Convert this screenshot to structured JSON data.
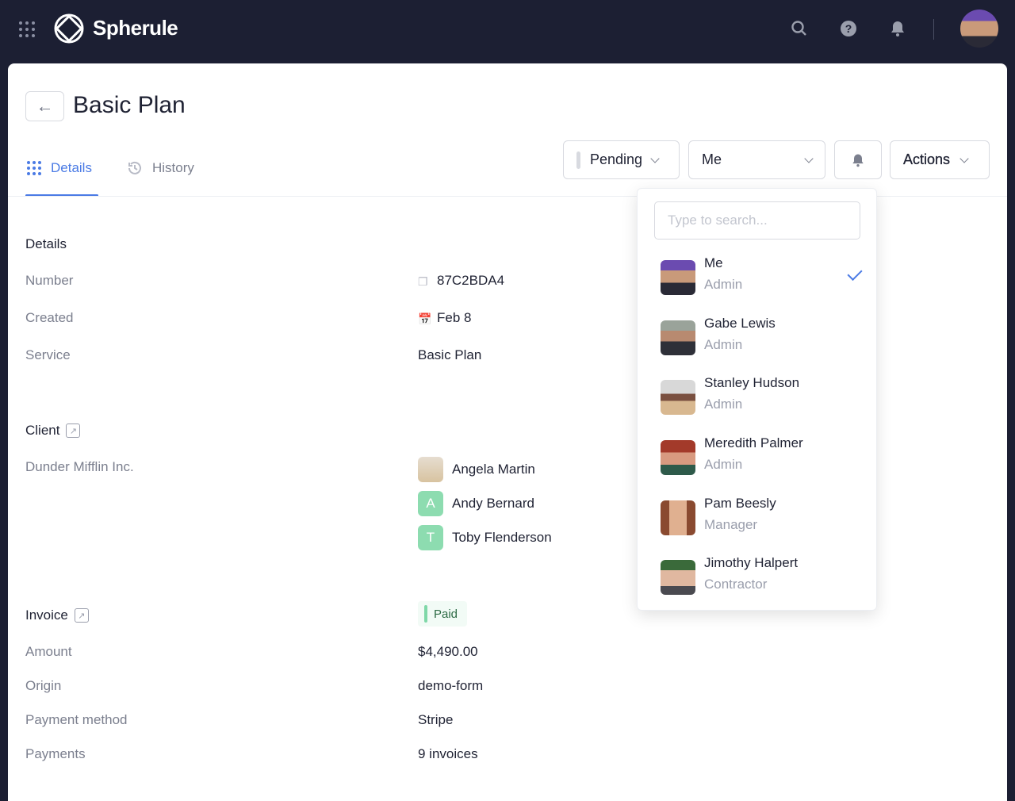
{
  "app": {
    "brand": "Spherule"
  },
  "page": {
    "title": "Basic Plan"
  },
  "tabs": [
    {
      "label": "Details",
      "active": true
    },
    {
      "label": "History",
      "active": false
    }
  ],
  "toolbar": {
    "status": "Pending",
    "assignee": "Me",
    "actions": "Actions"
  },
  "details": {
    "heading": "Details",
    "number_label": "Number",
    "number": "87C2BDA4",
    "created_label": "Created",
    "created": "Feb 8",
    "service_label": "Service",
    "service": "Basic Plan"
  },
  "client": {
    "heading": "Client",
    "name": "Dunder Mifflin Inc.",
    "contacts": [
      {
        "name": "Angela Martin",
        "initial": ""
      },
      {
        "name": "Andy Bernard",
        "initial": "A"
      },
      {
        "name": "Toby Flenderson",
        "initial": "T"
      }
    ]
  },
  "invoice": {
    "heading": "Invoice",
    "status": "Paid",
    "amount_label": "Amount",
    "amount": "$4,490.00",
    "origin_label": "Origin",
    "origin": "demo-form",
    "method_label": "Payment method",
    "method": "Stripe",
    "payments_label": "Payments",
    "payments": "9 invoices"
  },
  "assignee_dropdown": {
    "placeholder": "Type to search...",
    "options": [
      {
        "name": "Me",
        "role": "Admin",
        "selected": true
      },
      {
        "name": "Gabe Lewis",
        "role": "Admin"
      },
      {
        "name": "Stanley Hudson",
        "role": "Admin"
      },
      {
        "name": "Meredith Palmer",
        "role": "Admin"
      },
      {
        "name": "Pam Beesly",
        "role": "Manager"
      },
      {
        "name": "Jimothy Halpert",
        "role": "Contractor"
      }
    ]
  },
  "colors": {
    "topbar": "#1c1f33",
    "accent": "#4b7be5",
    "paid": "#7fd8a8"
  }
}
